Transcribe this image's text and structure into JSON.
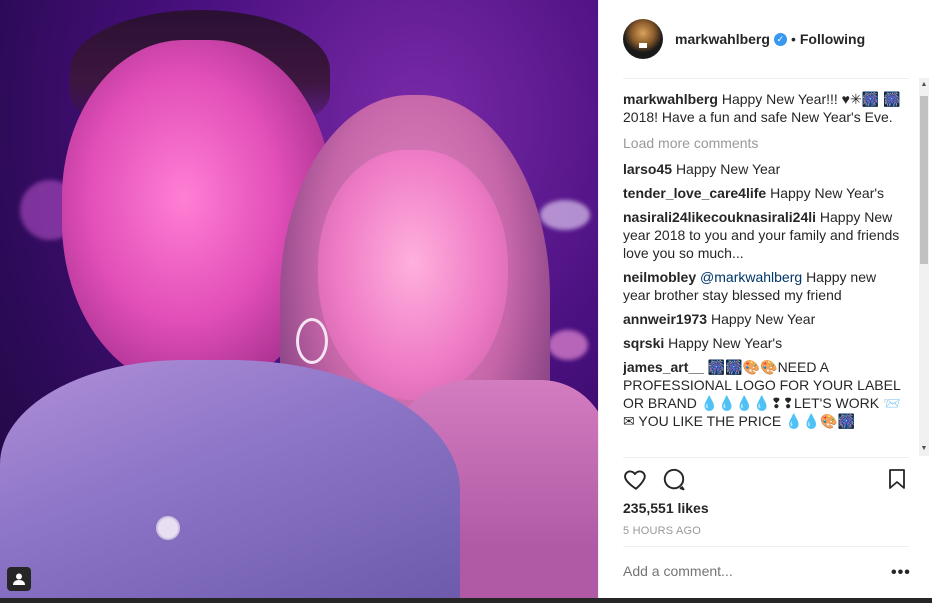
{
  "post": {
    "username": "markwahlberg",
    "verified_icon": "verified-badge-icon",
    "separator": "•",
    "follow_status": "Following"
  },
  "caption": {
    "user": "markwahlberg",
    "text": "Happy New Year!!! ♥✳🎆 🎆 2018! Have a fun and safe New Year's Eve."
  },
  "load_more": "Load more comments",
  "comments": [
    {
      "user": "larso45",
      "text": "Happy New Year"
    },
    {
      "user": "tender_love_care4life",
      "text": "Happy New Year's"
    },
    {
      "user": "nasirali24likecouknasirali24li",
      "text": "Happy New year 2018 to you and your family and friends love you so much..."
    },
    {
      "user": "neilmobley",
      "mention": "@markwahlberg",
      "text": "Happy new year brother stay blessed my friend"
    },
    {
      "user": "annweir1973",
      "text": "Happy New Year"
    },
    {
      "user": "sqrski",
      "text": "Happy New Year's"
    },
    {
      "user": "james_art__",
      "text": "🎆🎆🎨🎨NEED A PROFESSIONAL LOGO FOR YOUR LABEL OR BRAND 💧💧💧💧❢❢LET'S WORK 📨✉ YOU LIKE THE PRICE 💧💧🎨🎆"
    }
  ],
  "likes": "235,551 likes",
  "time": "5 HOURS AGO",
  "add_comment_placeholder": "Add a comment...",
  "more_label": "•••",
  "icons": {
    "like": "heart-icon",
    "comment": "comment-bubble-icon",
    "save": "bookmark-icon",
    "user_tag": "user-tag-icon"
  },
  "colors": {
    "text": "#262626",
    "muted": "#999999",
    "mention": "#003569",
    "verified": "#3897f0"
  }
}
